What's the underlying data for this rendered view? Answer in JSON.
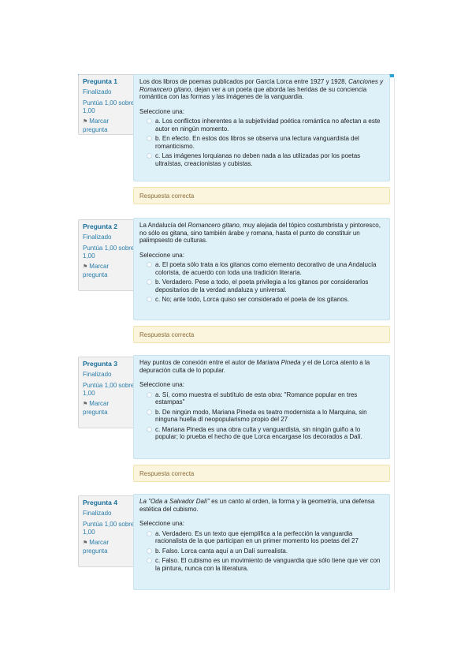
{
  "questions": [
    {
      "number": "Pregunta 1",
      "state": "Finalizado",
      "grade": "Puntúa 1,00 sobre 1,00",
      "flag": "Marcar pregunta",
      "text_a": "Los dos libros de poemas publicados por García Lorca entre 1927 y 1928, ",
      "text_i": "Canciones y Romancero gitano",
      "text_b": ", dejan ver a un poeta que aborda las heridas de su conciencia romántica con las formas y las imágenes de la vanguardia.",
      "prompt": "Seleccione una:",
      "options": [
        "a. Los conflictos inherentes a la subjetividad poética romántica no afectan a este autor en ningún momento.",
        "b. En efecto. En estos dos libros se observa una lectura vanguardista del romanticismo.",
        "c. Las imágenes lorquianas no deben nada a las utilizadas por los poetas ultraístas, creacionistas y cubistas."
      ],
      "feedback": "Respuesta correcta"
    },
    {
      "number": "Pregunta 2",
      "state": "Finalizado",
      "grade": "Puntúa 1,00 sobre 1,00",
      "flag": "Marcar pregunta",
      "text_a": "La Andalucía del ",
      "text_i": "Romancero gitano",
      "text_b": ", muy alejada del tópico costumbrista y pintoresco, no sólo es gitana, sino también árabe y romana, hasta el punto de constituir un palimpsesto de culturas.",
      "prompt": "Seleccione una:",
      "options": [
        "a. El poeta sólo trata a los gitanos como elemento decorativo de una Andalucía colorista, de acuerdo con toda una tradición literaria.",
        "b. Verdadero. Pese a todo, el poeta privilegia a los gitanos por considerarlos depositarios de la verdad andaluza y universal.",
        "c. No; ante todo, Lorca quiso ser considerado el poeta de los gitanos."
      ],
      "feedback": "Respuesta correcta"
    },
    {
      "number": "Pregunta 3",
      "state": "Finalizado",
      "grade": "Puntúa 1,00 sobre 1,00",
      "flag": "Marcar pregunta",
      "text_a": "Hay puntos de conexión entre el autor de ",
      "text_i": "Mariana Pineda",
      "text_b": " y el de Lorca atento a la depuración culta de lo popular.",
      "prompt": "Seleccione una:",
      "options": [
        "a. Sí, como muestra el subtítulo de esta obra: \"Romance popular en tres estampas\"",
        "b. De ningún modo, Mariana Pineda es teatro modernista a lo Marquina, sin ninguna huella dl neopopularismo propio del 27",
        "c. Mariana Pineda es una obra culta y vanguardista, sin ningún guiño a lo popular; lo prueba el hecho de que Lorca encargase los decorados a Dalí."
      ],
      "feedback": "Respuesta correcta"
    },
    {
      "number": "Pregunta 4",
      "state": "Finalizado",
      "grade": "Puntúa 1,00 sobre 1,00",
      "flag": "Marcar pregunta",
      "text_a": "",
      "text_i": "La \"Oda a Salvador Dalí\"",
      "text_b": " es un canto al orden, la forma y la geometría, una defensa estética del cubismo.",
      "prompt": "Seleccione una:",
      "options": [
        "a. Verdadero. Es un texto que ejemplifica a la perfección la vanguardia racionalista de la que participan en un primer momento los poetas del 27",
        "b. Falso. Lorca canta aquí a un Dalí surrealista.",
        "c. Falso. El cubismo es un movimiento de vanguardia que sólo tiene que ver con la pintura, nunca con la literatura."
      ],
      "feedback": ""
    }
  ]
}
